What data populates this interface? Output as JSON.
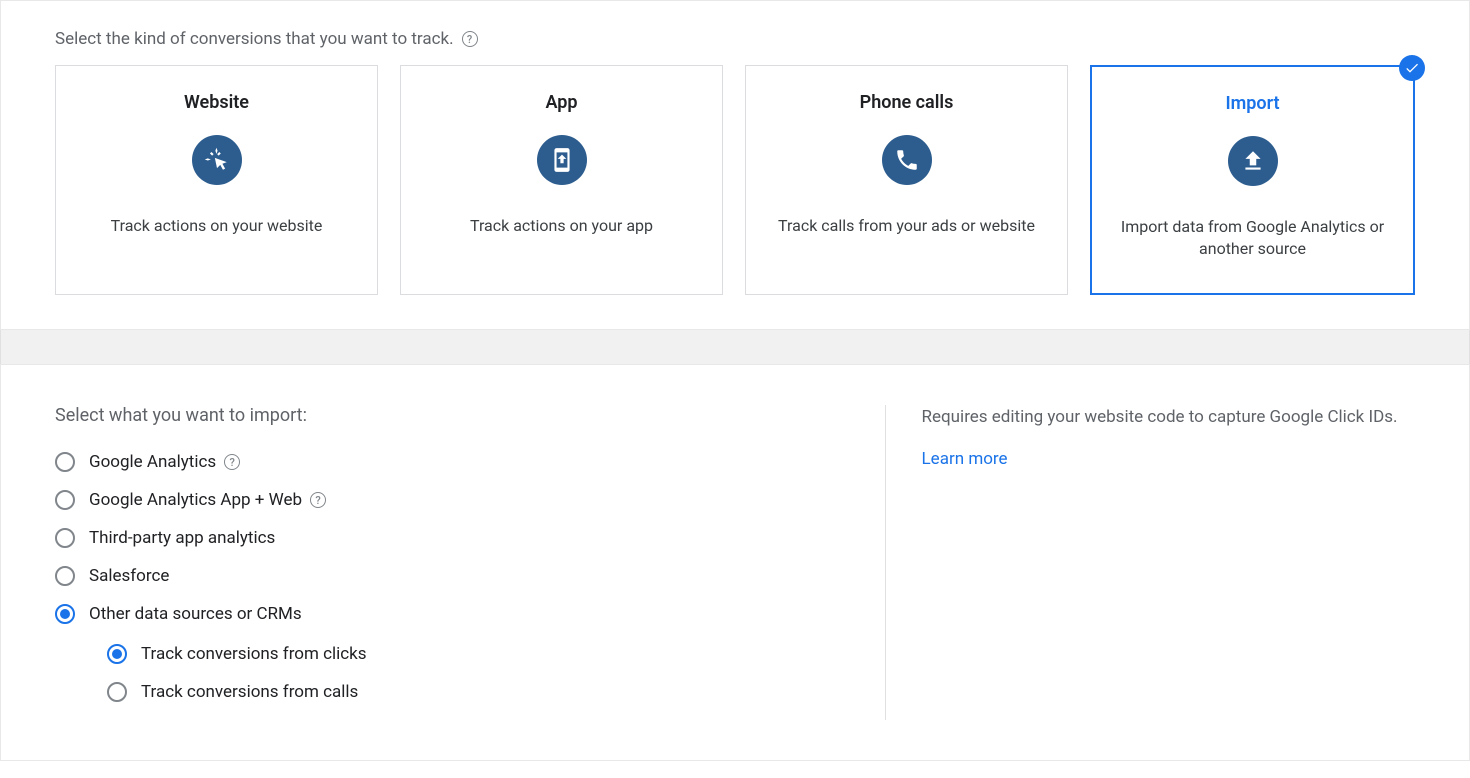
{
  "panel1": {
    "title": "Select the kind of conversions that you want to track.",
    "cards": [
      {
        "title": "Website",
        "desc": "Track actions on your website",
        "icon": "click",
        "selected": false
      },
      {
        "title": "App",
        "desc": "Track actions on your app",
        "icon": "phone-app",
        "selected": false
      },
      {
        "title": "Phone calls",
        "desc": "Track calls from your ads or website",
        "icon": "phone-call",
        "selected": false
      },
      {
        "title": "Import",
        "desc": "Import data from Google Analytics or another source",
        "icon": "upload",
        "selected": true
      }
    ]
  },
  "panel2": {
    "title": "Select what you want to import:",
    "options": [
      {
        "label": "Google Analytics",
        "help": true,
        "selected": false
      },
      {
        "label": "Google Analytics App + Web",
        "help": true,
        "selected": false
      },
      {
        "label": "Third-party app analytics",
        "help": false,
        "selected": false
      },
      {
        "label": "Salesforce",
        "help": false,
        "selected": false
      },
      {
        "label": "Other data sources or CRMs",
        "help": false,
        "selected": true
      }
    ],
    "subOptions": [
      {
        "label": "Track conversions from clicks",
        "selected": true
      },
      {
        "label": "Track conversions from calls",
        "selected": false
      }
    ],
    "info": "Requires editing your website code to capture Google Click IDs.",
    "learnMore": "Learn more"
  }
}
